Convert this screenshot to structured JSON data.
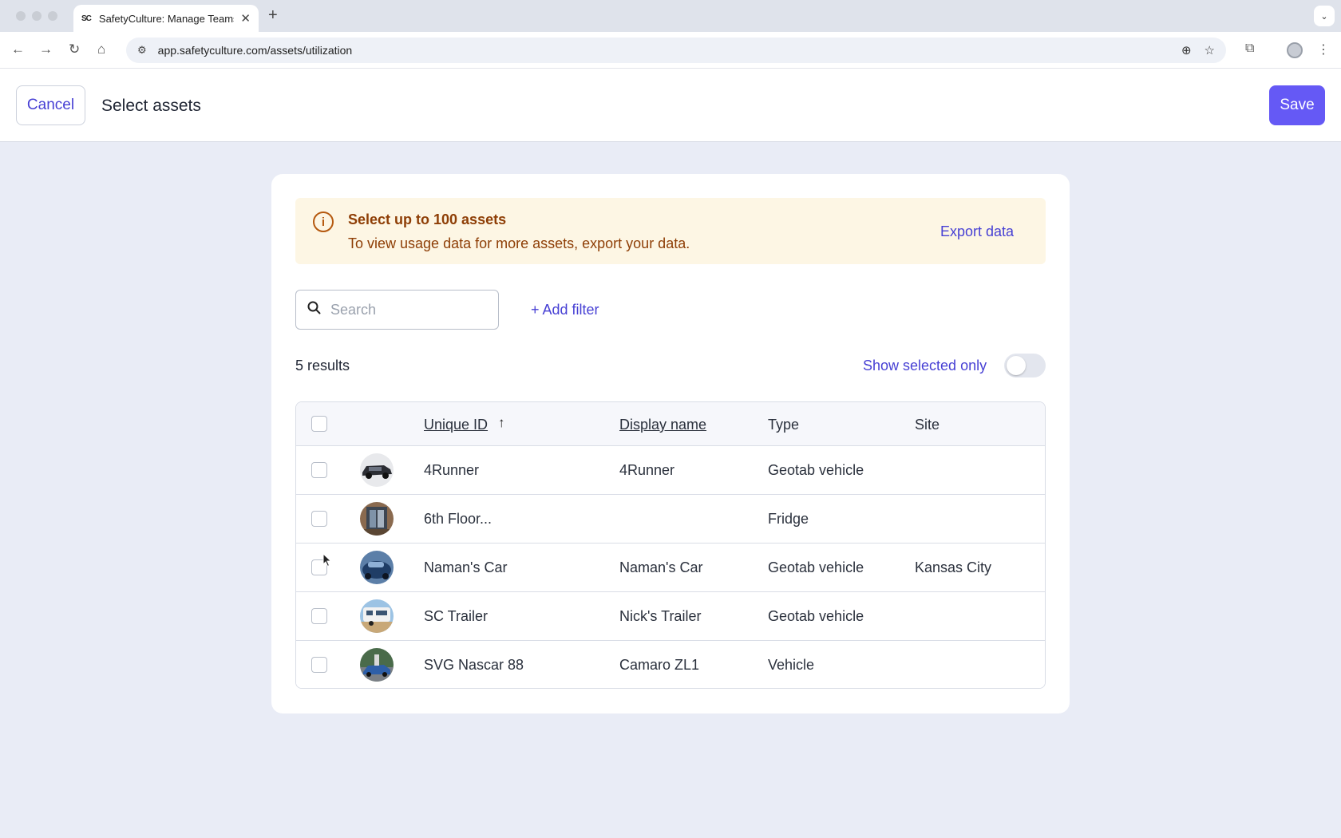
{
  "browser": {
    "tab_title": "SafetyCulture: Manage Teams",
    "favicon": "SC",
    "url": "app.safetyculture.com/assets/utilization"
  },
  "header": {
    "cancel_label": "Cancel",
    "title": "Select assets",
    "save_label": "Save"
  },
  "banner": {
    "title": "Select up to 100 assets",
    "text": "To view usage data for more assets, export your data.",
    "export_label": "Export data"
  },
  "search": {
    "placeholder": "Search"
  },
  "add_filter_label": "+ Add filter",
  "results_label": "5 results",
  "show_selected_label": "Show selected only",
  "show_selected_on": false,
  "table": {
    "columns": [
      "Unique ID",
      "Display name",
      "Type",
      "Site"
    ],
    "rows": [
      {
        "unique_id": "4Runner",
        "display_name": "4Runner",
        "type": "Geotab vehicle",
        "site": ""
      },
      {
        "unique_id": "6th Floor...",
        "display_name": "",
        "type": "Fridge",
        "site": ""
      },
      {
        "unique_id": "Naman's Car",
        "display_name": "Naman's Car",
        "type": "Geotab vehicle",
        "site": "Kansas City"
      },
      {
        "unique_id": "SC Trailer",
        "display_name": "Nick's Trailer",
        "type": "Geotab vehicle",
        "site": ""
      },
      {
        "unique_id": "SVG Nascar 88",
        "display_name": "Camaro ZL1",
        "type": "Vehicle",
        "site": ""
      }
    ]
  },
  "colors": {
    "primary": "#6559f5",
    "link": "#4740d4",
    "banner_bg": "#fdf6e4",
    "banner_text": "#8e3e06"
  }
}
